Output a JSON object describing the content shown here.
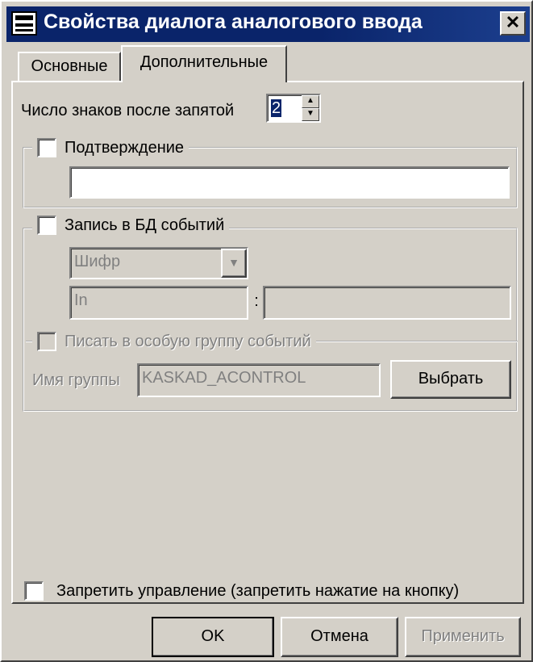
{
  "window": {
    "title": "Свойства диалога аналогового ввода",
    "close_glyph": "✕"
  },
  "tabs": [
    {
      "label": "Основные",
      "active": false
    },
    {
      "label": "Дополнительные",
      "active": true
    }
  ],
  "decimals": {
    "label": "Число знаков после запятой",
    "value": "2"
  },
  "confirmation": {
    "label": "Подтверждение",
    "checked": false,
    "text_value": ""
  },
  "event_db": {
    "label": "Запись в БД событий",
    "checked": false,
    "cipher_select": "Шифр",
    "field_left": "In",
    "separator": ":",
    "field_right": "",
    "special_group": {
      "label": "Писать в особую группу событий",
      "checked": false,
      "group_name_label": "Имя группы",
      "group_name_value": "KASKAD_ACONTROL",
      "choose_button": "Выбрать"
    }
  },
  "forbid_control": {
    "label": "Запретить управление (запретить нажатие на кнопку)",
    "checked": false
  },
  "buttons": {
    "ok": "OK",
    "cancel": "Отмена",
    "apply": "Применить"
  },
  "colors": {
    "titlebar": "#0a246a",
    "face": "#d4d0c8",
    "disabled_text": "#808080"
  }
}
